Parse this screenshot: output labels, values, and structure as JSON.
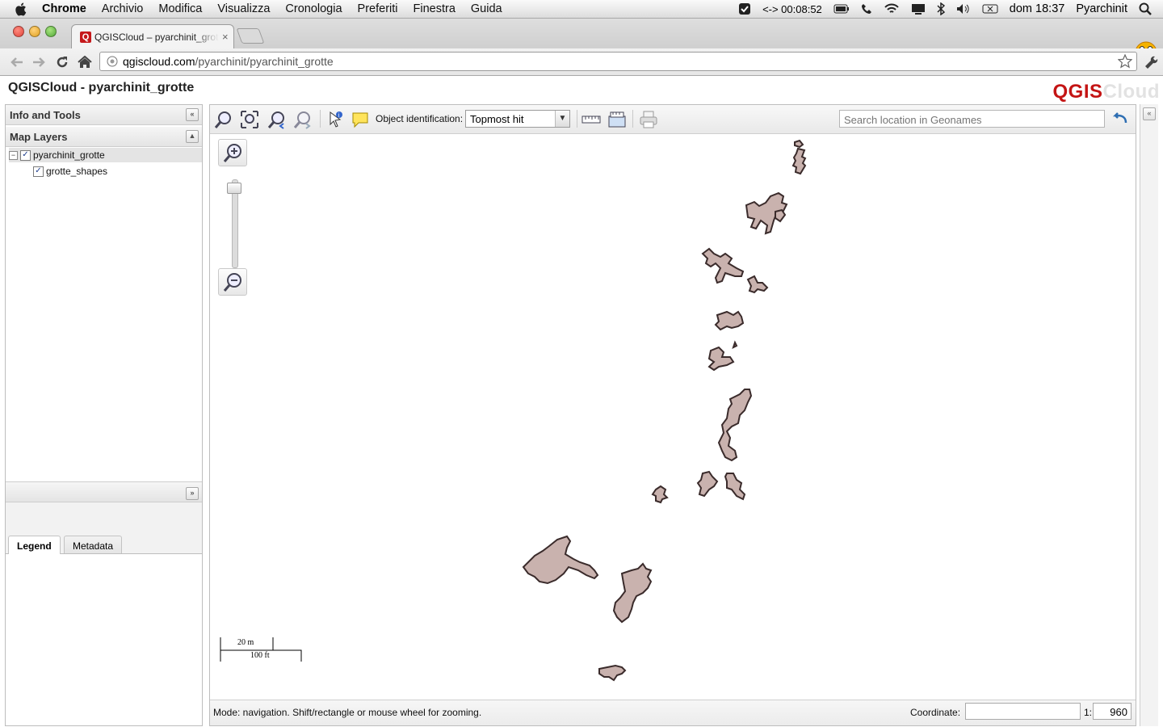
{
  "menubar": {
    "app": "Chrome",
    "items": [
      "Archivio",
      "Modifica",
      "Visualizza",
      "Cronologia",
      "Preferiti",
      "Finestra",
      "Guida"
    ],
    "timer": "<-> 00:08:52",
    "clock": "dom 18:37",
    "user": "Pyarchinit"
  },
  "browser": {
    "tab_title": "QGISCloud – pyarchinit_grotte",
    "tab_close": "×",
    "url_host": "qgiscloud.com",
    "url_path": "/pyarchinit/pyarchinit_grotte"
  },
  "page": {
    "title": "QGISCloud - pyarchinit_grotte",
    "logo_q": "QGIS",
    "logo_c": "Cloud"
  },
  "left_panel": {
    "info_tools": "Info and Tools",
    "map_layers": "Map Layers",
    "layers": [
      {
        "label": "pyarchinit_grotte",
        "checked": true
      },
      {
        "label": "grotte_shapes",
        "checked": true
      }
    ],
    "tabs": [
      "Legend",
      "Metadata"
    ],
    "active_tab": "Legend"
  },
  "map_toolbar": {
    "object_identification_label": "Object identification:",
    "object_identification_value": "Topmost hit",
    "search_placeholder": "Search location in Geonames"
  },
  "scalebar": {
    "top_label": "20 m",
    "bottom_label": "100 ft"
  },
  "status": {
    "mode_text": "Mode: navigation. Shift/rectangle or mouse wheel for zooming.",
    "coordinate_label": "Coordinate:",
    "coordinate_value": "",
    "scale_prefix": "1:",
    "scale_value": "960"
  },
  "colors": {
    "cave_fill": "#c9b2ae",
    "cave_stroke": "#3a2b2b",
    "logo_red": "#c41414"
  }
}
